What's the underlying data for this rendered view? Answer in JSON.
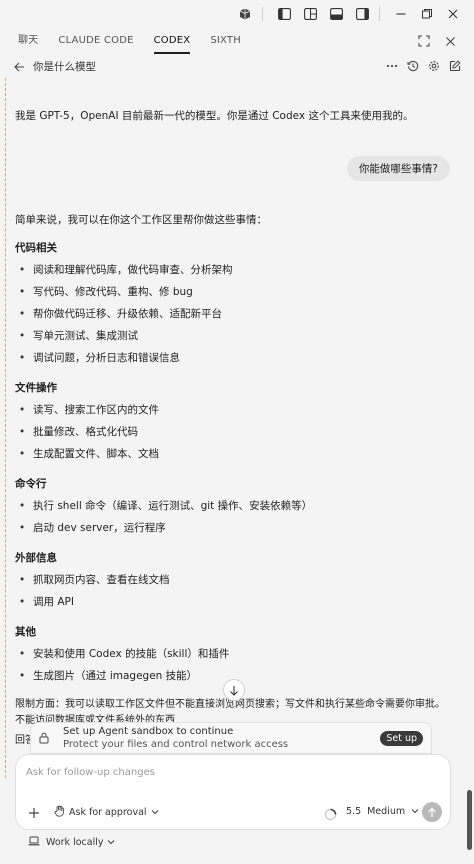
{
  "tabs": [
    {
      "label": "聊天"
    },
    {
      "label": "CLAUDE CODE"
    },
    {
      "label": "CODEX"
    },
    {
      "label": "SIXTH"
    }
  ],
  "header": {
    "title": "你是什么模型"
  },
  "messages": {
    "assistant_intro": "我是 GPT-5，OpenAI 目前最新一代的模型。你是通过 Codex 这个工具来使用我的。",
    "user_question": "你能做哪些事情?",
    "answer_lead": "简单来说，我可以在你这个工作区里帮你做这些事情：",
    "sections": [
      {
        "heading": "代码相关",
        "items": [
          "阅读和理解代码库，做代码审查、分析架构",
          "写代码、修改代码、重构、修 bug",
          "帮你做代码迁移、升级依赖、适配新平台",
          "写单元测试、集成测试",
          "调试问题，分析日志和错误信息"
        ]
      },
      {
        "heading": "文件操作",
        "items": [
          "读写、搜索工作区内的文件",
          "批量修改、格式化代码",
          "生成配置文件、脚本、文档"
        ]
      },
      {
        "heading": "命令行",
        "items": [
          "执行 shell 命令（编译、运行测试、git 操作、安装依赖等）",
          "启动 dev server，运行程序"
        ]
      },
      {
        "heading": "外部信息",
        "items": [
          "抓取网页内容、查看在线文档",
          "调用 API"
        ]
      },
      {
        "heading": "其他",
        "items": [
          "安装和使用 Codex 的技能（skill）和插件",
          "生成图片（通过 imagegen 技能）"
        ]
      }
    ],
    "limits_1": "限制方面：我可以读取工作区文件但不能直接浏览网页搜索；写文件和执行某些命令需要你审批。",
    "limits_2": "不能访问数据库或文件系统外的东西",
    "limits_3": "回答"
  },
  "banner": {
    "line1": "Set up Agent sandbox to continue",
    "line2": "Protect your files and control network access",
    "button": "Set up"
  },
  "composer": {
    "placeholder": "Ask for follow-up changes",
    "approval": "Ask for approval",
    "model_version": "5.5",
    "model_effort": "Medium"
  },
  "footer": {
    "label": "Work locally"
  }
}
